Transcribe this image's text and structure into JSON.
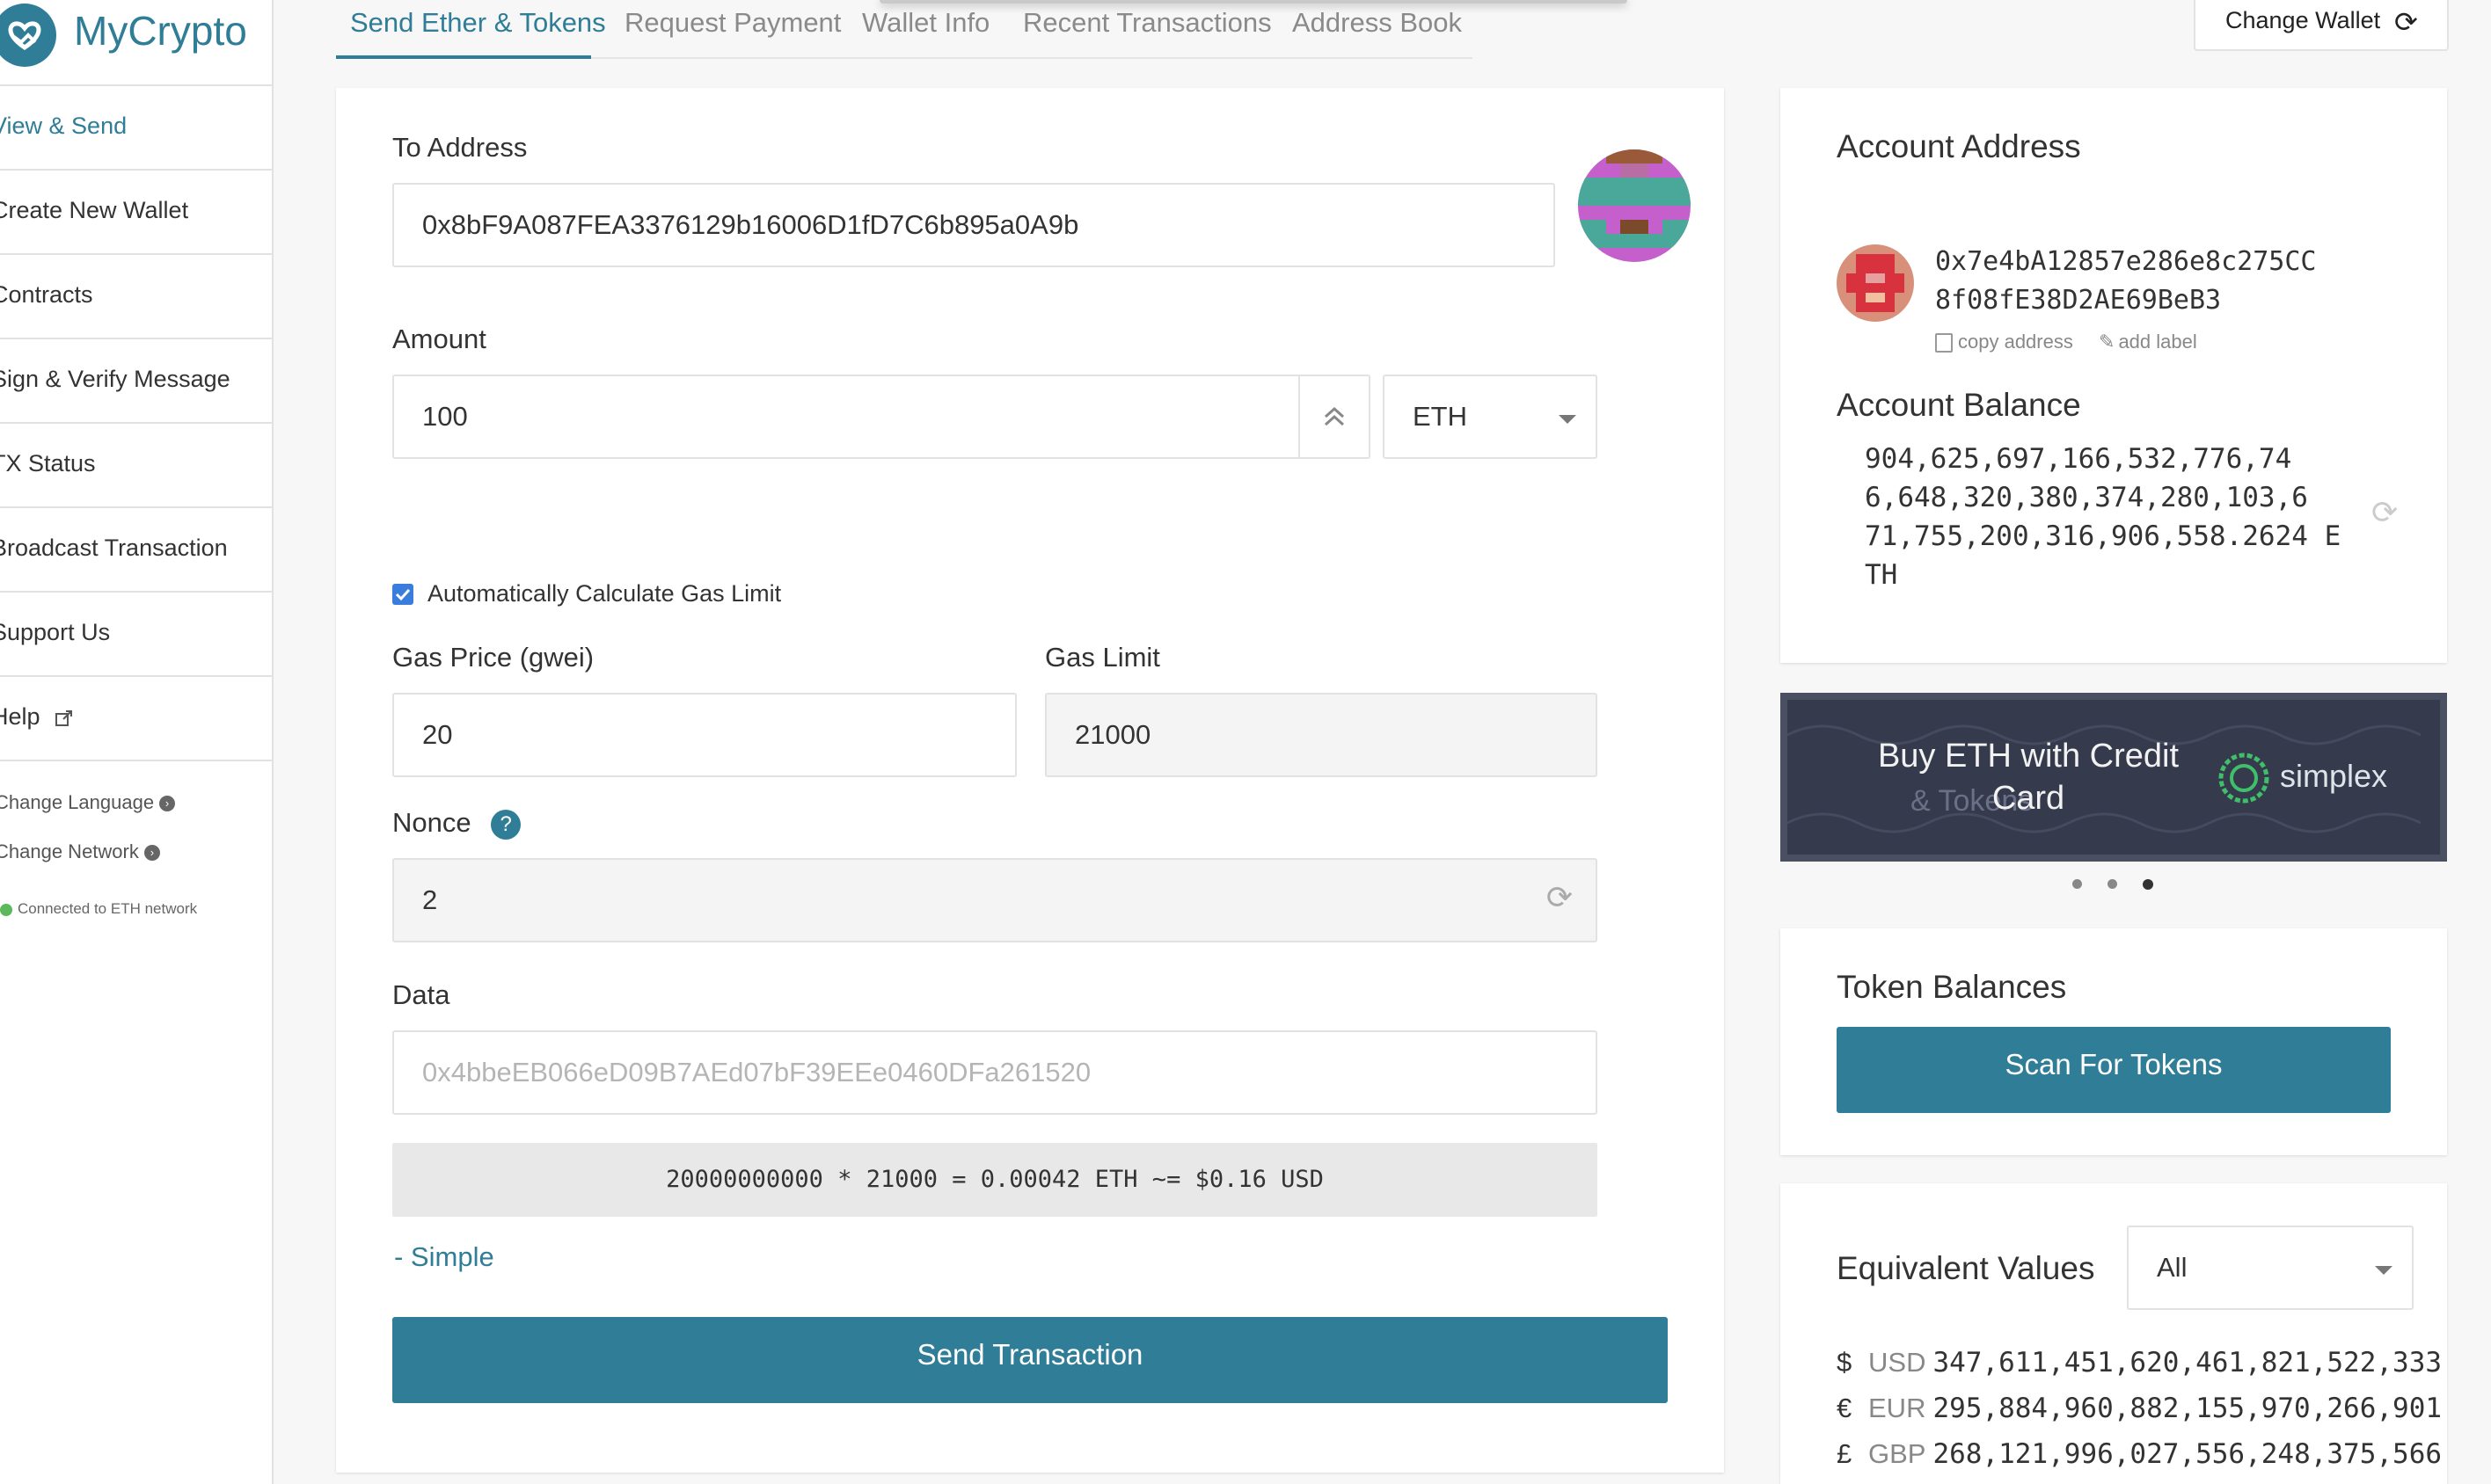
{
  "brand": {
    "name": "MyCrypto"
  },
  "sidebar": {
    "items": [
      {
        "label": "View & Send"
      },
      {
        "label": "Create New Wallet"
      },
      {
        "label": "Contracts"
      },
      {
        "label": "Sign & Verify Message"
      },
      {
        "label": "TX Status"
      },
      {
        "label": "Broadcast Transaction"
      },
      {
        "label": "Support Us"
      },
      {
        "label": "Help"
      }
    ],
    "change_language": "Change Language",
    "change_network": "Change Network",
    "network_status": "Connected to ETH network"
  },
  "tabs": [
    {
      "label": "Send Ether & Tokens"
    },
    {
      "label": "Request Payment"
    },
    {
      "label": "Wallet Info"
    },
    {
      "label": "Recent Transactions"
    },
    {
      "label": "Address Book"
    }
  ],
  "header": {
    "change_wallet": "Change Wallet"
  },
  "form": {
    "to_address_label": "To Address",
    "to_address_value": "0x8bF9A087FEA3376129b16006D1fD7C6b895a0A9b",
    "amount_label": "Amount",
    "amount_value": "100",
    "unit_value": "ETH",
    "auto_gas_label": "Automatically Calculate Gas Limit",
    "gas_price_label": "Gas Price (gwei)",
    "gas_price_value": "20",
    "gas_limit_label": "Gas Limit",
    "gas_limit_value": "21000",
    "nonce_label": "Nonce",
    "nonce_value": "2",
    "data_label": "Data",
    "data_placeholder": "0x4bbeEB066eD09B7AEd07bF39EEe0460DFa261520",
    "fee_summary": "20000000000 * 21000 = 0.00042 ETH ~= $0.16 USD",
    "simple_link": "- Simple",
    "send_button": "Send Transaction"
  },
  "account": {
    "title": "Account Address",
    "address_line1": "0x7e4bA12857e286e8c275CC",
    "address_line2": "8f08fE38D2AE69BeB3",
    "copy_address": "copy address",
    "add_label": "add label",
    "balance_title": "Account Balance",
    "balance_lines": [
      "904,625,697,166,532,776,74",
      "6,648,320,380,374,280,103,6",
      "71,755,200,316,906,558.2624 E",
      "TH"
    ]
  },
  "promo": {
    "text_line1": "Buy ETH with Credit",
    "text_line2": "Card",
    "ghost_text": "& Tokens",
    "partner": "simplex"
  },
  "tokens": {
    "title": "Token Balances",
    "scan_button": "Scan For Tokens"
  },
  "equivalent": {
    "title": "Equivalent Values",
    "select_value": "All",
    "rows": [
      {
        "symbol": "$",
        "code": "USD",
        "value": "347,611,451,620,461,821,522,333,"
      },
      {
        "symbol": "€",
        "code": "EUR",
        "value": "295,884,960,882,155,970,266,901,"
      },
      {
        "symbol": "£",
        "code": "GBP",
        "value": "268,121,996,027,556,248,375,566,"
      }
    ]
  },
  "colors": {
    "accent": "#2f7d96",
    "check": "#3b7ddd",
    "network_ok": "#5cb85c"
  }
}
